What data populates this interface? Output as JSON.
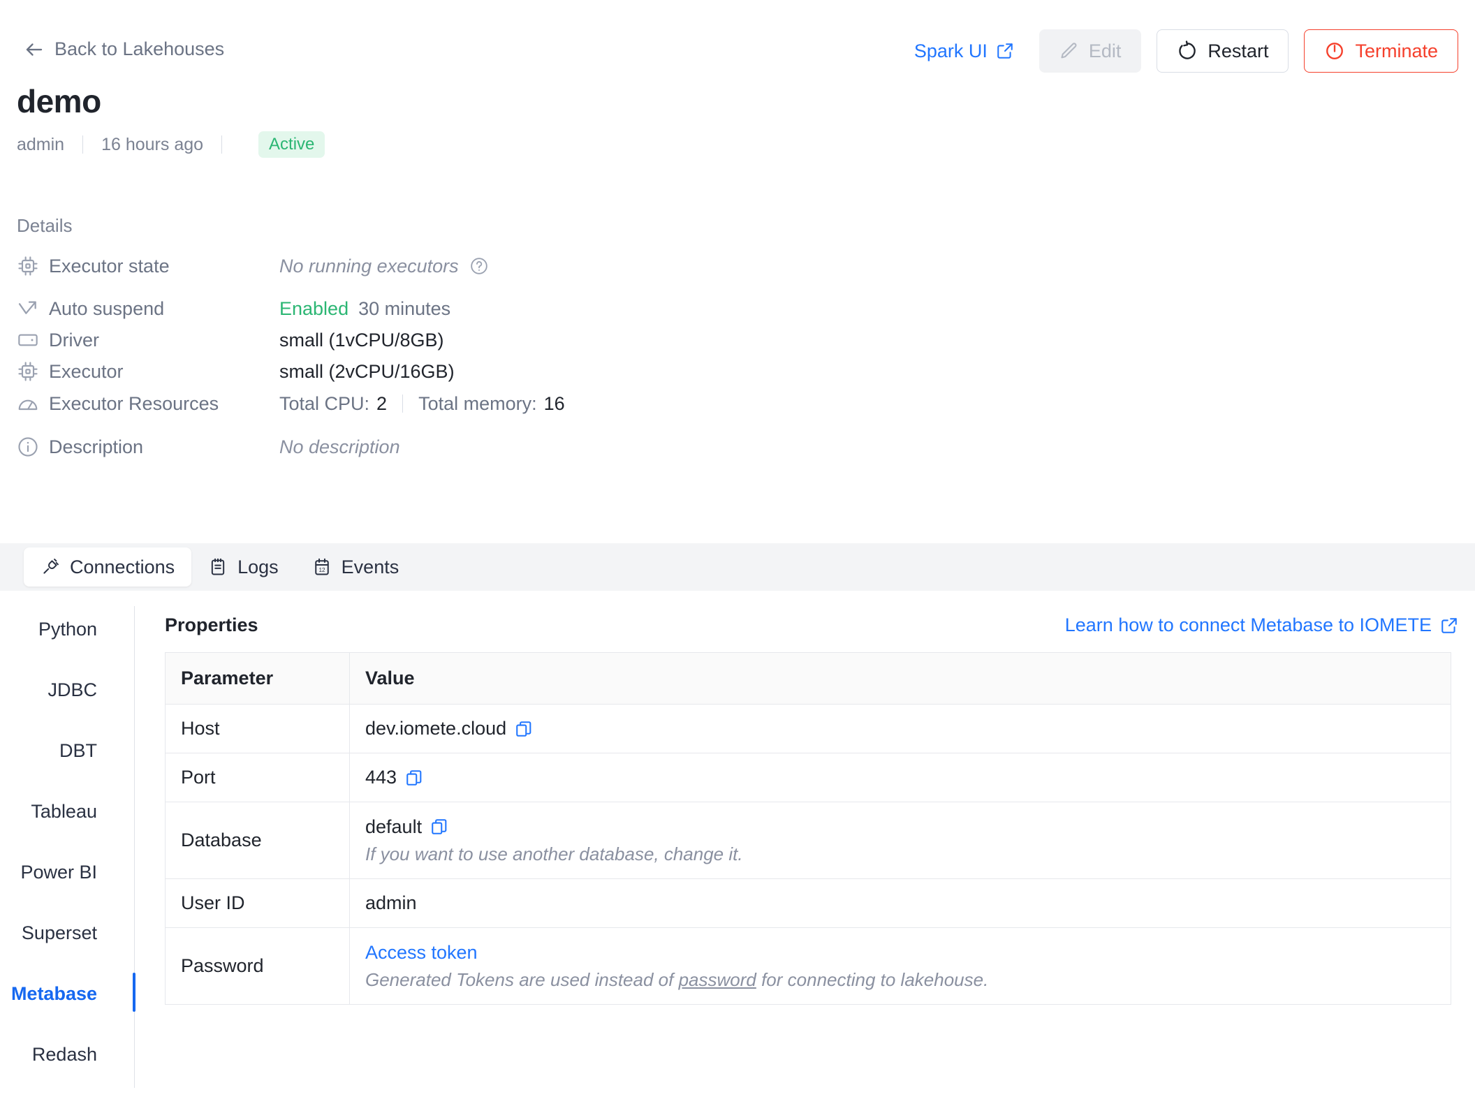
{
  "header": {
    "back_label": "Back to Lakehouses",
    "spark_ui_label": "Spark UI",
    "edit_label": "Edit",
    "restart_label": "Restart",
    "terminate_label": "Terminate"
  },
  "page": {
    "title": "demo",
    "owner": "admin",
    "updated": "16 hours ago",
    "status": "Active"
  },
  "details": {
    "section_label": "Details",
    "rows": [
      {
        "icon": "cpu-chip-icon",
        "key": "Executor state",
        "value": "No running executors",
        "style": "italic",
        "has_help": true
      },
      {
        "icon": "arrow-trend-icon",
        "key": "Auto suspend",
        "value_primary": "Enabled",
        "value_secondary": "30 minutes",
        "style": "split"
      },
      {
        "icon": "driver-card-icon",
        "key": "Driver",
        "value": "small (1vCPU/8GB)",
        "style": "plain"
      },
      {
        "icon": "cpu-chip-icon",
        "key": "Executor",
        "value": "small (2vCPU/16GB)",
        "style": "plain"
      },
      {
        "icon": "gauge-icon",
        "key": "Executor Resources",
        "cpu_label": "Total CPU:",
        "cpu_value": "2",
        "mem_label": "Total memory:",
        "mem_value": "16",
        "style": "resources"
      },
      {
        "icon": "info-circle-icon",
        "key": "Description",
        "value": "No description",
        "style": "italic",
        "has_help": false
      }
    ]
  },
  "tabs": [
    {
      "label": "Connections",
      "icon": "plug-icon",
      "active": true
    },
    {
      "label": "Logs",
      "icon": "notepad-icon",
      "active": false
    },
    {
      "label": "Events",
      "icon": "calendar-icon",
      "active": false
    }
  ],
  "connections_sidebar": {
    "items": [
      {
        "label": "Python",
        "selected": false
      },
      {
        "label": "JDBC",
        "selected": false
      },
      {
        "label": "DBT",
        "selected": false
      },
      {
        "label": "Tableau",
        "selected": false
      },
      {
        "label": "Power BI",
        "selected": false
      },
      {
        "label": "Superset",
        "selected": false
      },
      {
        "label": "Metabase",
        "selected": true
      },
      {
        "label": "Redash",
        "selected": false
      }
    ]
  },
  "properties": {
    "title": "Properties",
    "learn_link": "Learn how to connect Metabase to IOMETE",
    "columns": [
      "Parameter",
      "Value"
    ],
    "rows": {
      "host": {
        "param": "Host",
        "value": "dev.iomete.cloud"
      },
      "port": {
        "param": "Port",
        "value": "443"
      },
      "database": {
        "param": "Database",
        "value": "default",
        "note": "If you want to use another database, change it."
      },
      "user_id": {
        "param": "User ID",
        "value": "admin"
      },
      "password": {
        "param": "Password",
        "link": "Access token",
        "note_before": "Generated Tokens are used instead of ",
        "note_underlined": "password",
        "note_after": " for connecting to lakehouse."
      }
    }
  },
  "colors": {
    "accent_blue": "#2176ff",
    "link_blue": "#1668f0",
    "danger_red": "#f5402c",
    "success_green": "#2bb673",
    "muted_gray": "#6b7384"
  }
}
